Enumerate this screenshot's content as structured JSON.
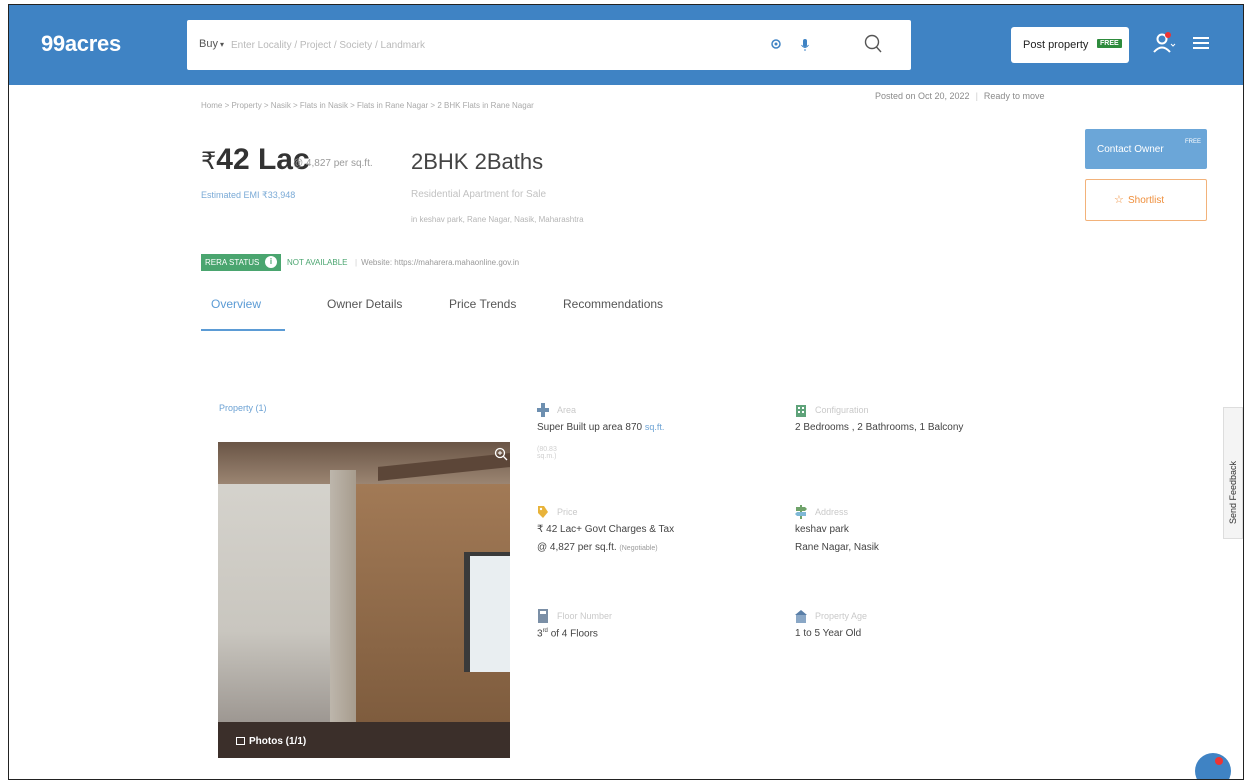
{
  "header": {
    "logo": "99acres",
    "buy_label": "Buy",
    "search_placeholder": "Enter Locality / Project / Society / Landmark",
    "post_property_label": "Post property",
    "free_badge": "FREE"
  },
  "breadcrumb": "Home > Property > Nasik > Flats in Nasik > Flats in Rane Nagar > 2 BHK Flats in Rane Nagar",
  "posted": {
    "date": "Posted on Oct 20, 2022",
    "status": "Ready to move"
  },
  "listing": {
    "currency": "₹",
    "price": "42 Lac",
    "per_sqft": "@ 4,827 per sq.ft.",
    "emi": "Estimated EMI ₹33,948",
    "title": "2BHK 2Baths",
    "subtitle": "Residential Apartment for Sale",
    "address": "in keshav park, Rane Nagar, Nasik, Maharashtra"
  },
  "actions": {
    "contact_owner": "Contact Owner",
    "contact_free": "FREE",
    "shortlist": "Shortlist"
  },
  "rera": {
    "badge": "RERA STATUS",
    "status": "NOT AVAILABLE",
    "website": "Website: https://maharera.mahaonline.gov.in"
  },
  "tabs": [
    "Overview",
    "Owner Details",
    "Price Trends",
    "Recommendations"
  ],
  "gallery": {
    "label": "Property (1)",
    "photos_label": "Photos (1/1)"
  },
  "details": {
    "area": {
      "label": "Area",
      "value": "Super Built up area 870",
      "unit": "sq.ft.",
      "sub": "(80.83 sq.m.)"
    },
    "configuration": {
      "label": "Configuration",
      "value": "2 Bedrooms , 2 Bathrooms, 1 Balcony"
    },
    "price": {
      "label": "Price",
      "value": "₹ 42 Lac+ Govt Charges & Tax",
      "per_sqft": "@ 4,827 per sq.ft.",
      "negotiable": "(Negotiable)"
    },
    "address": {
      "label": "Address",
      "line1": "keshav park",
      "line2": "Rane Nagar, Nasik"
    },
    "floor": {
      "label": "Floor Number",
      "floor_number": "3",
      "floor_suffix": "rd",
      "floor_total": "of 4 Floors"
    },
    "age": {
      "label": "Property Age",
      "value": "1 to 5 Year Old"
    }
  },
  "feedback": "Send Feedback",
  "colors": {
    "header_blue": "#3f83c4",
    "accent_blue": "#5b9bd5",
    "rera_green": "#4aa56f",
    "shortlist_orange": "#ef8f3c"
  }
}
